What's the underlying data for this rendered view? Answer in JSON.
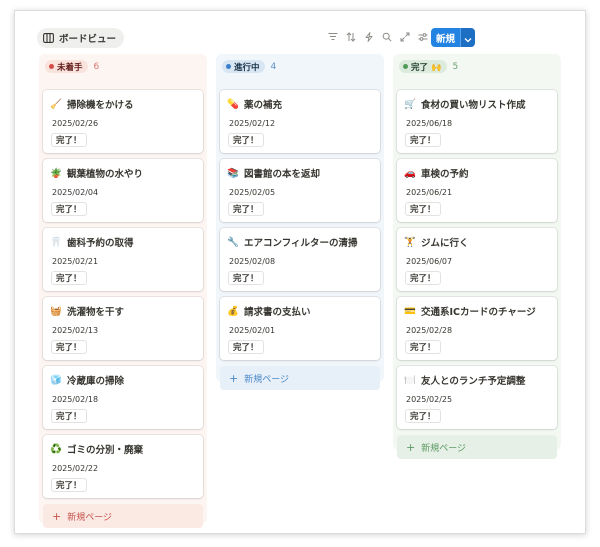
{
  "toolbar": {
    "view_label": "ボードビュー",
    "new_label": "新規"
  },
  "colors": {
    "accent": "#2383e2",
    "todo_bg": "#fdf5f2",
    "todo_pill": "#fbe3dd",
    "todo_dot": "#d44c47",
    "doing_bg": "#f1f6fb",
    "doing_pill": "#d8e6f4",
    "doing_dot": "#3a7fcb",
    "done_bg": "#f3f8f3",
    "done_pill": "#dcebdc",
    "done_dot": "#4f9a5a"
  },
  "columns": [
    {
      "label": "未着手",
      "count": "6",
      "new_page": "新規ページ",
      "cards": [
        {
          "emoji": "🧹",
          "title": "掃除機をかける",
          "date": "2025/02/26",
          "tag": "完了！"
        },
        {
          "emoji": "🪴",
          "title": "観葉植物の水やり",
          "date": "2025/02/04",
          "tag": "完了！"
        },
        {
          "emoji": "🦷",
          "title": "歯科予約の取得",
          "date": "2025/02/21",
          "tag": "完了！"
        },
        {
          "emoji": "🧺",
          "title": "洗濯物を干す",
          "date": "2025/02/13",
          "tag": "完了！"
        },
        {
          "emoji": "🧊",
          "title": "冷蔵庫の掃除",
          "date": "2025/02/18",
          "tag": "完了！"
        },
        {
          "emoji": "♻️",
          "title": "ゴミの分別・廃棄",
          "date": "2025/02/22",
          "tag": "完了！"
        }
      ]
    },
    {
      "label": "進行中",
      "count": "4",
      "new_page": "新規ページ",
      "cards": [
        {
          "emoji": "💊",
          "title": "薬の補充",
          "date": "2025/02/12",
          "tag": "完了！"
        },
        {
          "emoji": "📚",
          "title": "図書館の本を返却",
          "date": "2025/02/05",
          "tag": "完了！"
        },
        {
          "emoji": "🔧",
          "title": "エアコンフィルターの清掃",
          "date": "2025/02/08",
          "tag": "完了！"
        },
        {
          "emoji": "💰",
          "title": "請求書の支払い",
          "date": "2025/02/01",
          "tag": "完了！"
        }
      ]
    },
    {
      "label": "完了 🙌",
      "count": "5",
      "new_page": "新規ページ",
      "cards": [
        {
          "emoji": "🛒",
          "title": "食材の買い物リスト作成",
          "date": "2025/06/18",
          "tag": "完了！"
        },
        {
          "emoji": "🚗",
          "title": "車検の予約",
          "date": "2025/06/21",
          "tag": "完了！"
        },
        {
          "emoji": "🏋️",
          "title": "ジムに行く",
          "date": "2025/06/07",
          "tag": "完了！"
        },
        {
          "emoji": "💳",
          "title": "交通系ICカードのチャージ",
          "date": "2025/02/28",
          "tag": "完了！"
        },
        {
          "emoji": "🍽️",
          "title": "友人とのランチ予定調整",
          "date": "2025/02/25",
          "tag": "完了！"
        }
      ]
    }
  ]
}
